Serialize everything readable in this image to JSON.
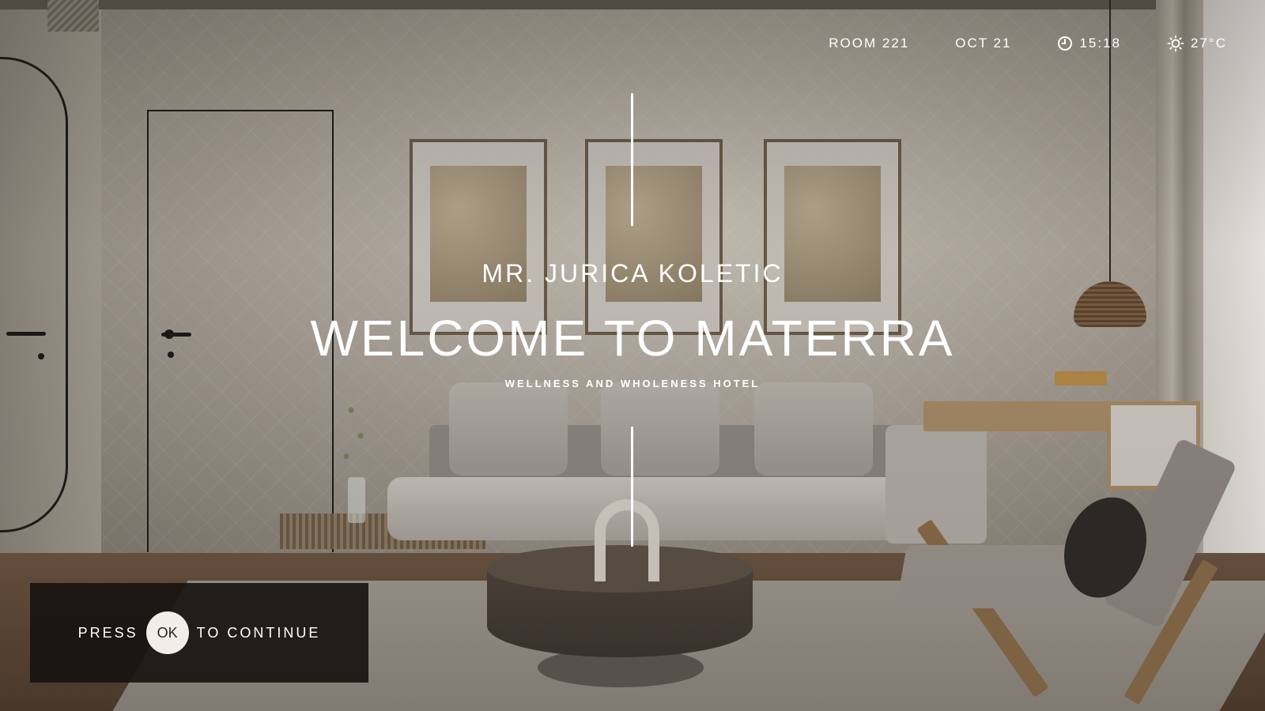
{
  "status_bar": {
    "room": "ROOM 221",
    "date": "OCT 21",
    "time": "15:18",
    "temperature": "27°C",
    "icons": {
      "time": "clock-icon",
      "weather": "sun-icon"
    }
  },
  "welcome": {
    "guest_name": "MR. JURICA KOLETIC",
    "title": "WELCOME TO MATERRA",
    "tagline": "WELLNESS AND WHOLENESS HOTEL"
  },
  "continue_prompt": {
    "before": "PRESS",
    "button_label": "OK",
    "after": "TO CONTINUE"
  },
  "colors": {
    "text": "#ffffff",
    "panel": "#161210",
    "ok_button": "#f2ede6"
  }
}
